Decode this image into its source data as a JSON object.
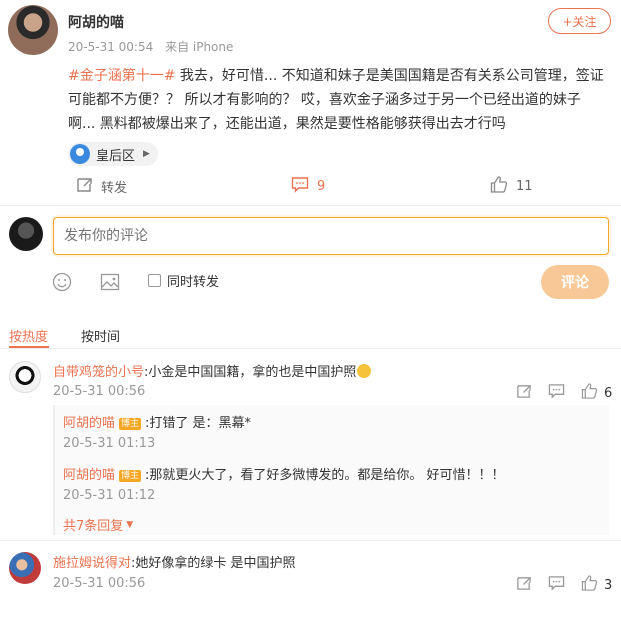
{
  "post": {
    "username": "阿胡的喵",
    "time": "20-5-31 00:54",
    "source": "来自 iPhone",
    "follow_label": "+关注",
    "hashtag": "#金子涵第十一#",
    "text": " 我去，好可惜... 不知道和妹子是美国国籍是否有关系公司管理，签证可能都不方便？？ 所以才有影响的？ 哎，喜欢金子涵多过于另一个已经出道的妹子啊... 黑料都被爆出来了，还能出道，果然是要性格能够获得出去才行吗",
    "location": "皇后区",
    "actions": {
      "repost_label": "转发",
      "comment_count": "9",
      "like_count": "11"
    }
  },
  "composer": {
    "placeholder": "发布你的评论",
    "repost_checkbox_label": "同时转发",
    "submit_label": "评论"
  },
  "sort_tabs": [
    "按热度",
    "按时间"
  ],
  "comments": [
    {
      "username": "自带鸡笼的小号",
      "text": ":小金是中国国籍，拿的也是中国护照",
      "time": "20-5-31 00:56",
      "like_count": "6",
      "replies": [
        {
          "username": "阿胡的喵",
          "badge": "博主",
          "text": ":打错了 是：黑幕*",
          "time": "20-5-31 01:13"
        },
        {
          "username": "阿胡的喵",
          "badge": "博主",
          "text": ":那就更火大了，看了好多微博发的。都是给你。 好可惜！！！",
          "time": "20-5-31 01:12"
        }
      ],
      "more_replies_label": "共7条回复"
    },
    {
      "username": "施拉姆说得对",
      "text": ":她好像拿的绿卡 是中国护照",
      "time": "20-5-31 00:56",
      "like_count": "3"
    }
  ],
  "icons": {
    "repost": "repost-icon",
    "comment": "comment-icon",
    "like": "like-icon",
    "emoji": "emoji-icon",
    "image": "image-icon",
    "location": "location-pin-icon"
  },
  "colors": {
    "accent": "#eb7350",
    "submit_disabled": "#f8c897",
    "input_focus": "#f5a623"
  }
}
